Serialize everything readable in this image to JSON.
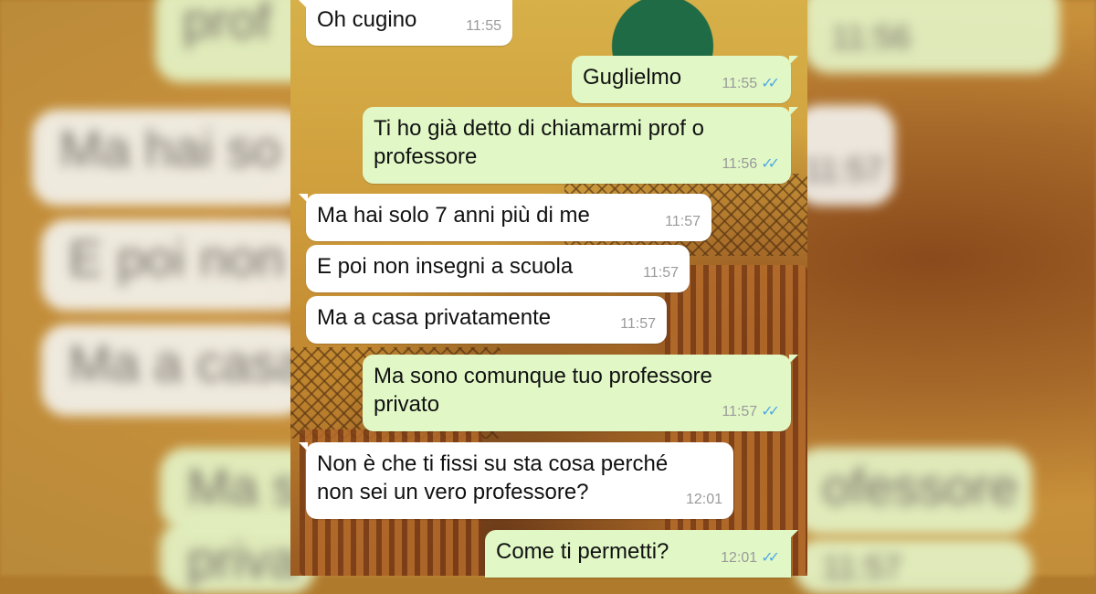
{
  "chat": {
    "messages": [
      {
        "direction": "in",
        "text": "Oh cugino",
        "time": "11:55"
      },
      {
        "direction": "out",
        "text": "Guglielmo",
        "time": "11:55",
        "ticks": "read"
      },
      {
        "direction": "out",
        "text": "Ti ho già detto di chiamarmi prof o\nprofessore",
        "time": "11:56",
        "ticks": "read"
      },
      {
        "direction": "in",
        "text": "Ma hai solo 7 anni più di me",
        "time": "11:57"
      },
      {
        "direction": "in",
        "text": "E poi non insegni a scuola",
        "time": "11:57"
      },
      {
        "direction": "in",
        "text": "Ma a casa privatamente",
        "time": "11:57"
      },
      {
        "direction": "out",
        "text": "Ma sono comunque tuo professore\nprivato",
        "time": "11:57",
        "ticks": "read"
      },
      {
        "direction": "in",
        "text": "Non è che ti fissi su sta cosa perché\nnon sei un vero professore?",
        "time": "12:01"
      },
      {
        "direction": "out",
        "text": "Come ti permetti?",
        "time": "12:01",
        "ticks": "read"
      }
    ],
    "tick_glyph": "✓✓",
    "colors": {
      "incoming_bubble": "#ffffff",
      "outgoing_bubble": "#e1f8c6",
      "read_ticks": "#4fa8e8",
      "timestamp": "#9a9a9a"
    }
  },
  "backdrop": {
    "left": [
      "prof",
      "Ma hai so",
      "E poi non",
      "Ma a casa",
      "Ma s",
      "priva"
    ],
    "right": [
      "11:56",
      "11:57",
      "ofessore",
      "11:57"
    ]
  }
}
